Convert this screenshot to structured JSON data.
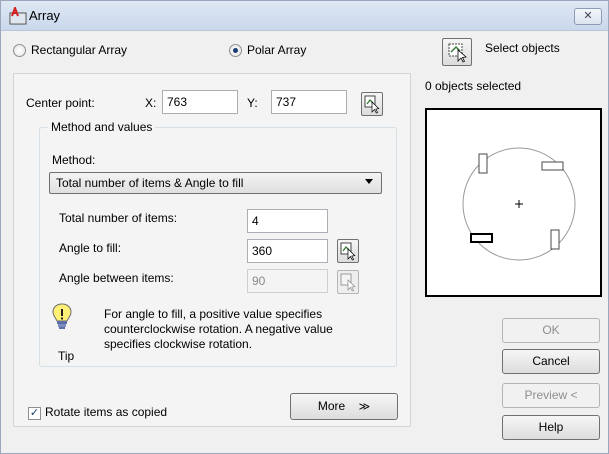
{
  "window": {
    "title": "Array",
    "close_label": "✕"
  },
  "array_type": {
    "rectangular_label": "Rectangular Array",
    "polar_label": "Polar Array",
    "selected": "polar"
  },
  "select_objects": {
    "label": "Select objects",
    "status": "0 objects selected"
  },
  "center_point": {
    "label": "Center point:",
    "x_label": "X:",
    "x_value": "763",
    "y_label": "Y:",
    "y_value": "737"
  },
  "method_group": {
    "title": "Method and values",
    "method_label": "Method:",
    "method_value": "Total number of items & Angle to fill",
    "total_items_label": "Total number of items:",
    "total_items_value": "4",
    "angle_fill_label": "Angle to fill:",
    "angle_fill_value": "360",
    "angle_between_label": "Angle between items:",
    "angle_between_value": "90"
  },
  "tip": {
    "text": "For angle to fill, a positive value specifies counterclockwise rotation.  A negative value specifies clockwise rotation.",
    "label": "Tip"
  },
  "rotate_items": {
    "label": "Rotate items as copied",
    "checked": true
  },
  "buttons": {
    "more": "More",
    "more_icon": "double-chevron-down-icon",
    "ok": "OK",
    "cancel": "Cancel",
    "preview": "Preview <",
    "help": "Help"
  },
  "colors": {
    "titlebar": "#c9d8ec",
    "accent": "#1c3e74"
  }
}
